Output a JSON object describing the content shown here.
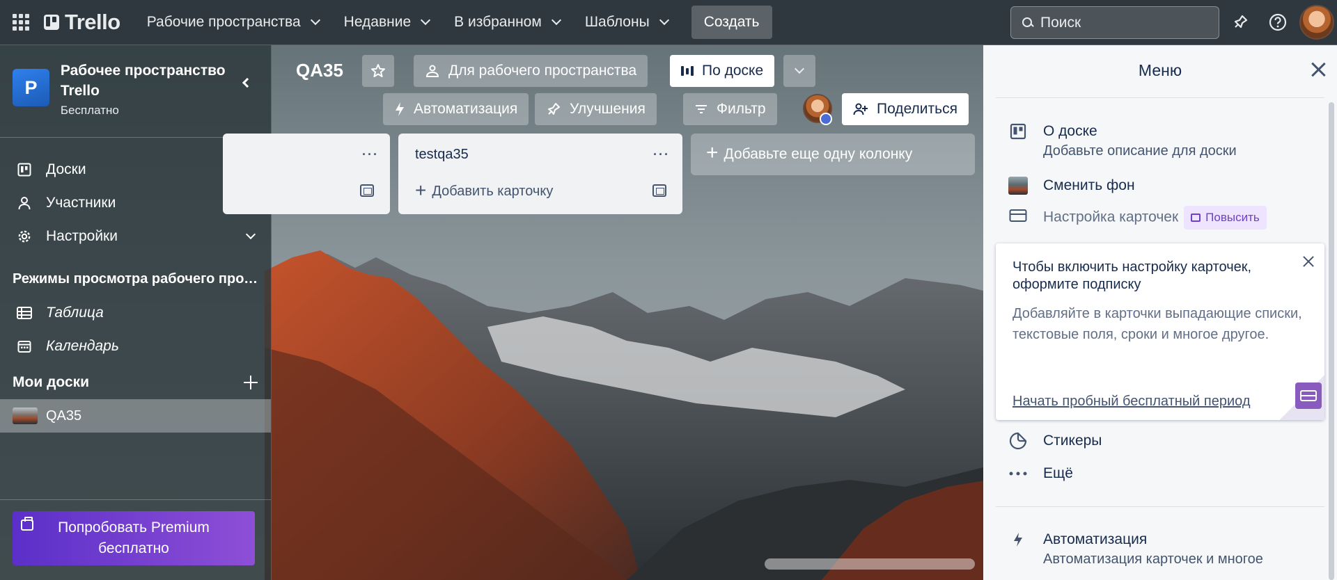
{
  "topbar": {
    "logo": "Trello",
    "nav": [
      {
        "label": "Рабочие пространства"
      },
      {
        "label": "Недавние"
      },
      {
        "label": "В избранном"
      },
      {
        "label": "Шаблоны"
      }
    ],
    "create_label": "Создать",
    "search_placeholder": "Поиск",
    "icons": [
      "apps-icon",
      "notifications-icon",
      "help-icon"
    ]
  },
  "sidebar": {
    "workspace_initial": "P",
    "workspace_name": "Рабочее пространство Trello",
    "workspace_plan": "Бесплатно",
    "items": [
      {
        "label": "Доски",
        "icon": "board-icon"
      },
      {
        "label": "Участники",
        "icon": "user-icon"
      },
      {
        "label": "Настройки",
        "icon": "gear-icon"
      }
    ],
    "views_title": "Режимы просмотра рабочего пространства",
    "views": [
      {
        "label": "Таблица",
        "icon": "table-icon"
      },
      {
        "label": "Календарь",
        "icon": "calendar-icon"
      }
    ],
    "my_boards_title": "Мои доски",
    "boards": [
      {
        "label": "QA35"
      }
    ],
    "premium_label": "Попробовать Premium бесплатно"
  },
  "board": {
    "title": "QA35",
    "visibility_label": "Для рабочего пространства",
    "view_label": "По доске",
    "automation_label": "Автоматизация",
    "powerups_label": "Улучшения",
    "filter_label": "Фильтр",
    "share_label": "Поделиться",
    "lists": [
      {
        "title": "",
        "add_card_label": "Добавить карточку"
      },
      {
        "title": "testqa35",
        "add_card_label": "Добавить карточку"
      }
    ],
    "add_list_label": "Добавьте еще одну колонку"
  },
  "menu": {
    "title": "Меню",
    "about_title": "О доске",
    "about_sub": "Добавьте описание для доски",
    "background_label": "Сменить фон",
    "cards_settings_label": "Настройка карточек",
    "upgrade_label": "Повысить",
    "promo": {
      "title": "Чтобы включить настройку карточек, оформите подписку",
      "text": "Добавляйте в карточки выпадающие списки, текстовые поля, сроки и многое другое.",
      "link": "Начать пробный бесплатный период"
    },
    "stickers_label": "Стикеры",
    "more_label": "Ещё",
    "automation_title": "Автоматизация",
    "automation_sub": "Автоматизация карточек и многое"
  },
  "colors": {
    "accent": "#2f80ed",
    "premium_start": "#5b2fc9",
    "premium_end": "#8e4fd6",
    "upgrade_bg": "#efe4ff",
    "upgrade_text": "#6e3fc9"
  }
}
